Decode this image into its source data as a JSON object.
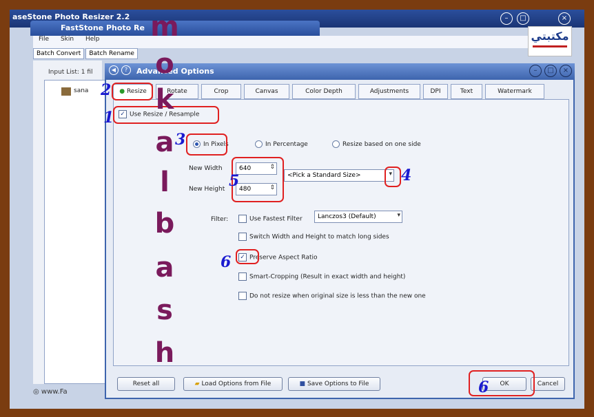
{
  "back_window": {
    "title": "aseStone Photo Resizer 2.2",
    "subtitle": "FastStone Photo Re",
    "menu": [
      "File",
      "Skin",
      "Help"
    ],
    "tabs": [
      "Batch Convert",
      "Batch Rename"
    ],
    "input_list_label": "Input List: 1 fil",
    "list_item": "sana",
    "status": "www.Fa"
  },
  "dialog": {
    "title": "Advanced Options",
    "tabs": [
      "Resize",
      "Rotate",
      "Crop",
      "Canvas",
      "Color Depth",
      "Adjustments",
      "DPI",
      "Text",
      "Watermark"
    ],
    "use_resize": "Use Resize / Resample",
    "resize_modes": [
      "In Pixels",
      "In Percentage",
      "Resize based on one side"
    ],
    "new_width_label": "New Width",
    "new_width_value": "640",
    "new_height_label": "New Height",
    "new_height_value": "480",
    "standard_size": "<Pick a Standard Size>",
    "filter_label": "Filter:",
    "use_fastest": "Use Fastest Filter",
    "filter_value": "Lanczos3 (Default)",
    "switch_wh": "Switch Width and Height to match long sides",
    "preserve_aspect": "Preserve Aspect Ratio",
    "smart_crop": "Smart-Cropping (Result in exact width and height)",
    "no_resize_smaller": "Do not resize when original size is less than the new one",
    "buttons": {
      "reset": "Reset all",
      "load": "Load Options from File",
      "save": "Save Options to File",
      "ok": "OK",
      "cancel": "Cancel"
    }
  },
  "annotations": {
    "step_numbers": [
      "1",
      "2",
      "3",
      "4",
      "5",
      "6",
      "6"
    ],
    "watermark_letters": [
      "m",
      "o",
      "k",
      "a",
      "l",
      "b",
      "a",
      "s",
      "h"
    ]
  },
  "logo_text": "مكتبتي",
  "colors": {
    "frame": "#7a3c10",
    "annotation_red": "#e02020",
    "step_blue": "#1a1ad0",
    "watermark_purple": "#7a1a5c",
    "title_blue": "#3d64ad"
  }
}
